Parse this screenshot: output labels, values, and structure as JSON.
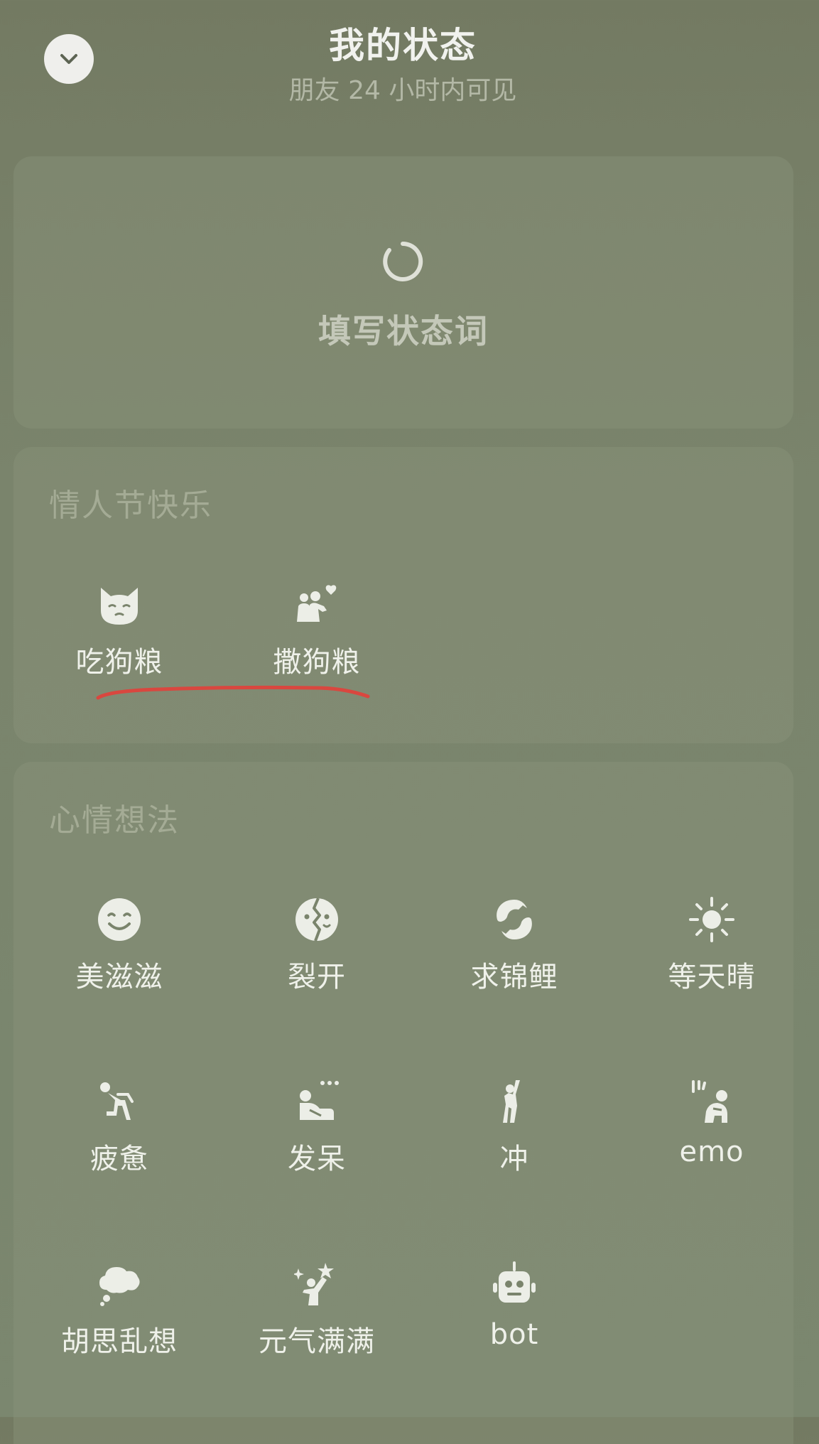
{
  "header": {
    "title": "我的状态",
    "subtitle": "朋友 24 小时内可见",
    "back_icon": "chevron-down-icon"
  },
  "status_card": {
    "prompt": "填写状态词",
    "icon": "loading-spinner-icon"
  },
  "valentine": {
    "title": "情人节快乐",
    "items": [
      {
        "label": "吃狗粮",
        "icon": "smug-cat-icon"
      },
      {
        "label": "撒狗粮",
        "icon": "couple-heart-icon"
      }
    ],
    "annotation_color": "#d9473f"
  },
  "mood": {
    "title": "心情想法",
    "items": [
      {
        "label": "美滋滋",
        "icon": "smiling-face-icon"
      },
      {
        "label": "裂开",
        "icon": "cracked-face-icon"
      },
      {
        "label": "求锦鲤",
        "icon": "koi-fish-icon"
      },
      {
        "label": "等天晴",
        "icon": "sun-icon"
      },
      {
        "label": "疲惫",
        "icon": "exhausted-person-icon"
      },
      {
        "label": "发呆",
        "icon": "daydream-person-icon"
      },
      {
        "label": "冲",
        "icon": "charge-person-icon"
      },
      {
        "label": "emo",
        "icon": "emo-person-icon"
      },
      {
        "label": "胡思乱想",
        "icon": "thought-cloud-icon"
      },
      {
        "label": "元气满满",
        "icon": "energetic-person-icon"
      },
      {
        "label": "bot",
        "icon": "robot-icon"
      }
    ]
  },
  "colors": {
    "background": "#7a846c",
    "card": "#858d75",
    "text_primary": "#eff1ea",
    "text_muted": "#a4ab95"
  }
}
